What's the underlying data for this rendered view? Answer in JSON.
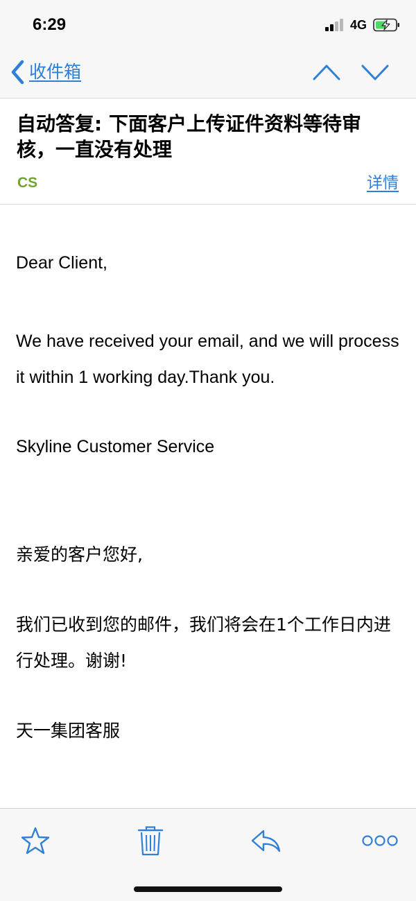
{
  "status_bar": {
    "time": "6:29",
    "network": "4G",
    "icons": [
      "signal-icon",
      "battery-charging-icon"
    ]
  },
  "nav": {
    "back_label": "收件箱",
    "icons": [
      "chevron-left-icon",
      "chevron-up-icon",
      "chevron-down-icon"
    ]
  },
  "email": {
    "subject": "自动答复: 下面客户上传证件资料等待审核，一直没有处理",
    "sender": "CS",
    "details_label": "详情",
    "body": {
      "greeting_en": "Dear Client,",
      "message_en": "We have received your email, and we will process it within 1 working day.Thank you.",
      "signature_en": "Skyline Customer Service",
      "greeting_cn": "亲爱的客户您好,",
      "message_cn": "我们已收到您的邮件，我们将会在1个工作日内进行处理。谢谢!",
      "signature_cn": "天一集团客服"
    }
  },
  "toolbar": {
    "icons": [
      "star-icon",
      "trash-icon",
      "reply-icon",
      "more-icon"
    ]
  },
  "colors": {
    "accent": "#2f7fd6",
    "sender": "#6fa52d",
    "chrome_bg": "#f7f7f7"
  }
}
